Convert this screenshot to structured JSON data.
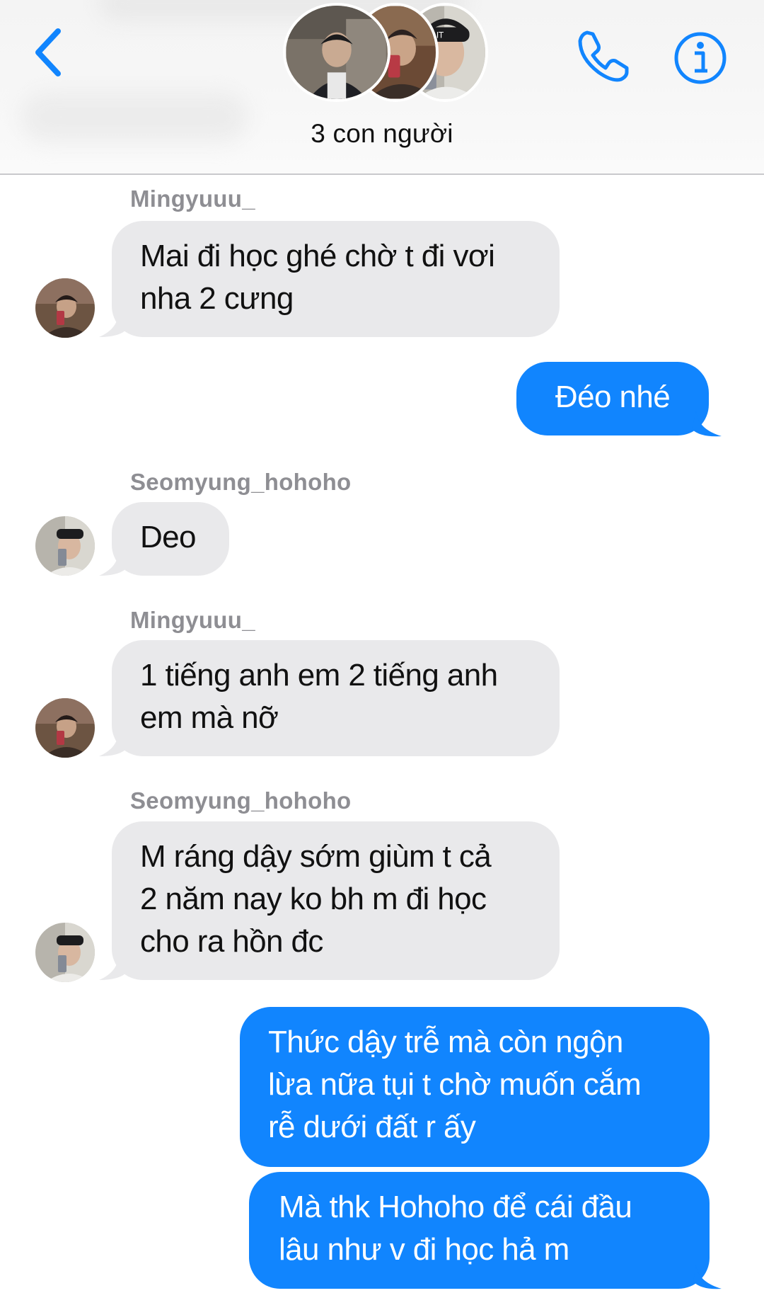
{
  "header": {
    "group_name": "3 con người",
    "back_icon": "chevron-left-icon",
    "call_icon": "phone-icon",
    "info_icon": "info-circle-icon",
    "accent": "#1185fe"
  },
  "messages": [
    {
      "sender": "Mingyuuu_",
      "direction": "incoming",
      "lines": [
        "Mai đi học ghé chờ t đi vơi",
        "nha 2 cưng"
      ]
    },
    {
      "direction": "outgoing",
      "lines": [
        "Đéo nhé"
      ]
    },
    {
      "sender": "Seomyung_hohoho",
      "direction": "incoming",
      "lines": [
        "Deo"
      ]
    },
    {
      "sender": "Mingyuuu_",
      "direction": "incoming",
      "lines": [
        "1 tiếng anh em 2 tiếng anh",
        "em mà nỡ"
      ]
    },
    {
      "sender": "Seomyung_hohoho",
      "direction": "incoming",
      "lines": [
        "M ráng dậy sớm giùm t cả",
        "2 năm nay ko bh m đi học",
        "cho ra hồn đc"
      ]
    },
    {
      "direction": "outgoing",
      "lines": [
        "Thức dậy trễ mà còn ngộn",
        "lừa nữa tụi t chờ muốn cắm",
        "rễ dưới đất r ấy"
      ]
    },
    {
      "direction": "outgoing",
      "lines": [
        "Mà thk Hohoho để cái đầu",
        "lâu như v đi học hả m"
      ]
    }
  ],
  "colors": {
    "incoming_bubble": "#e9e9eb",
    "outgoing_bubble": "#1185fe",
    "sender_name": "#8e8e93"
  }
}
